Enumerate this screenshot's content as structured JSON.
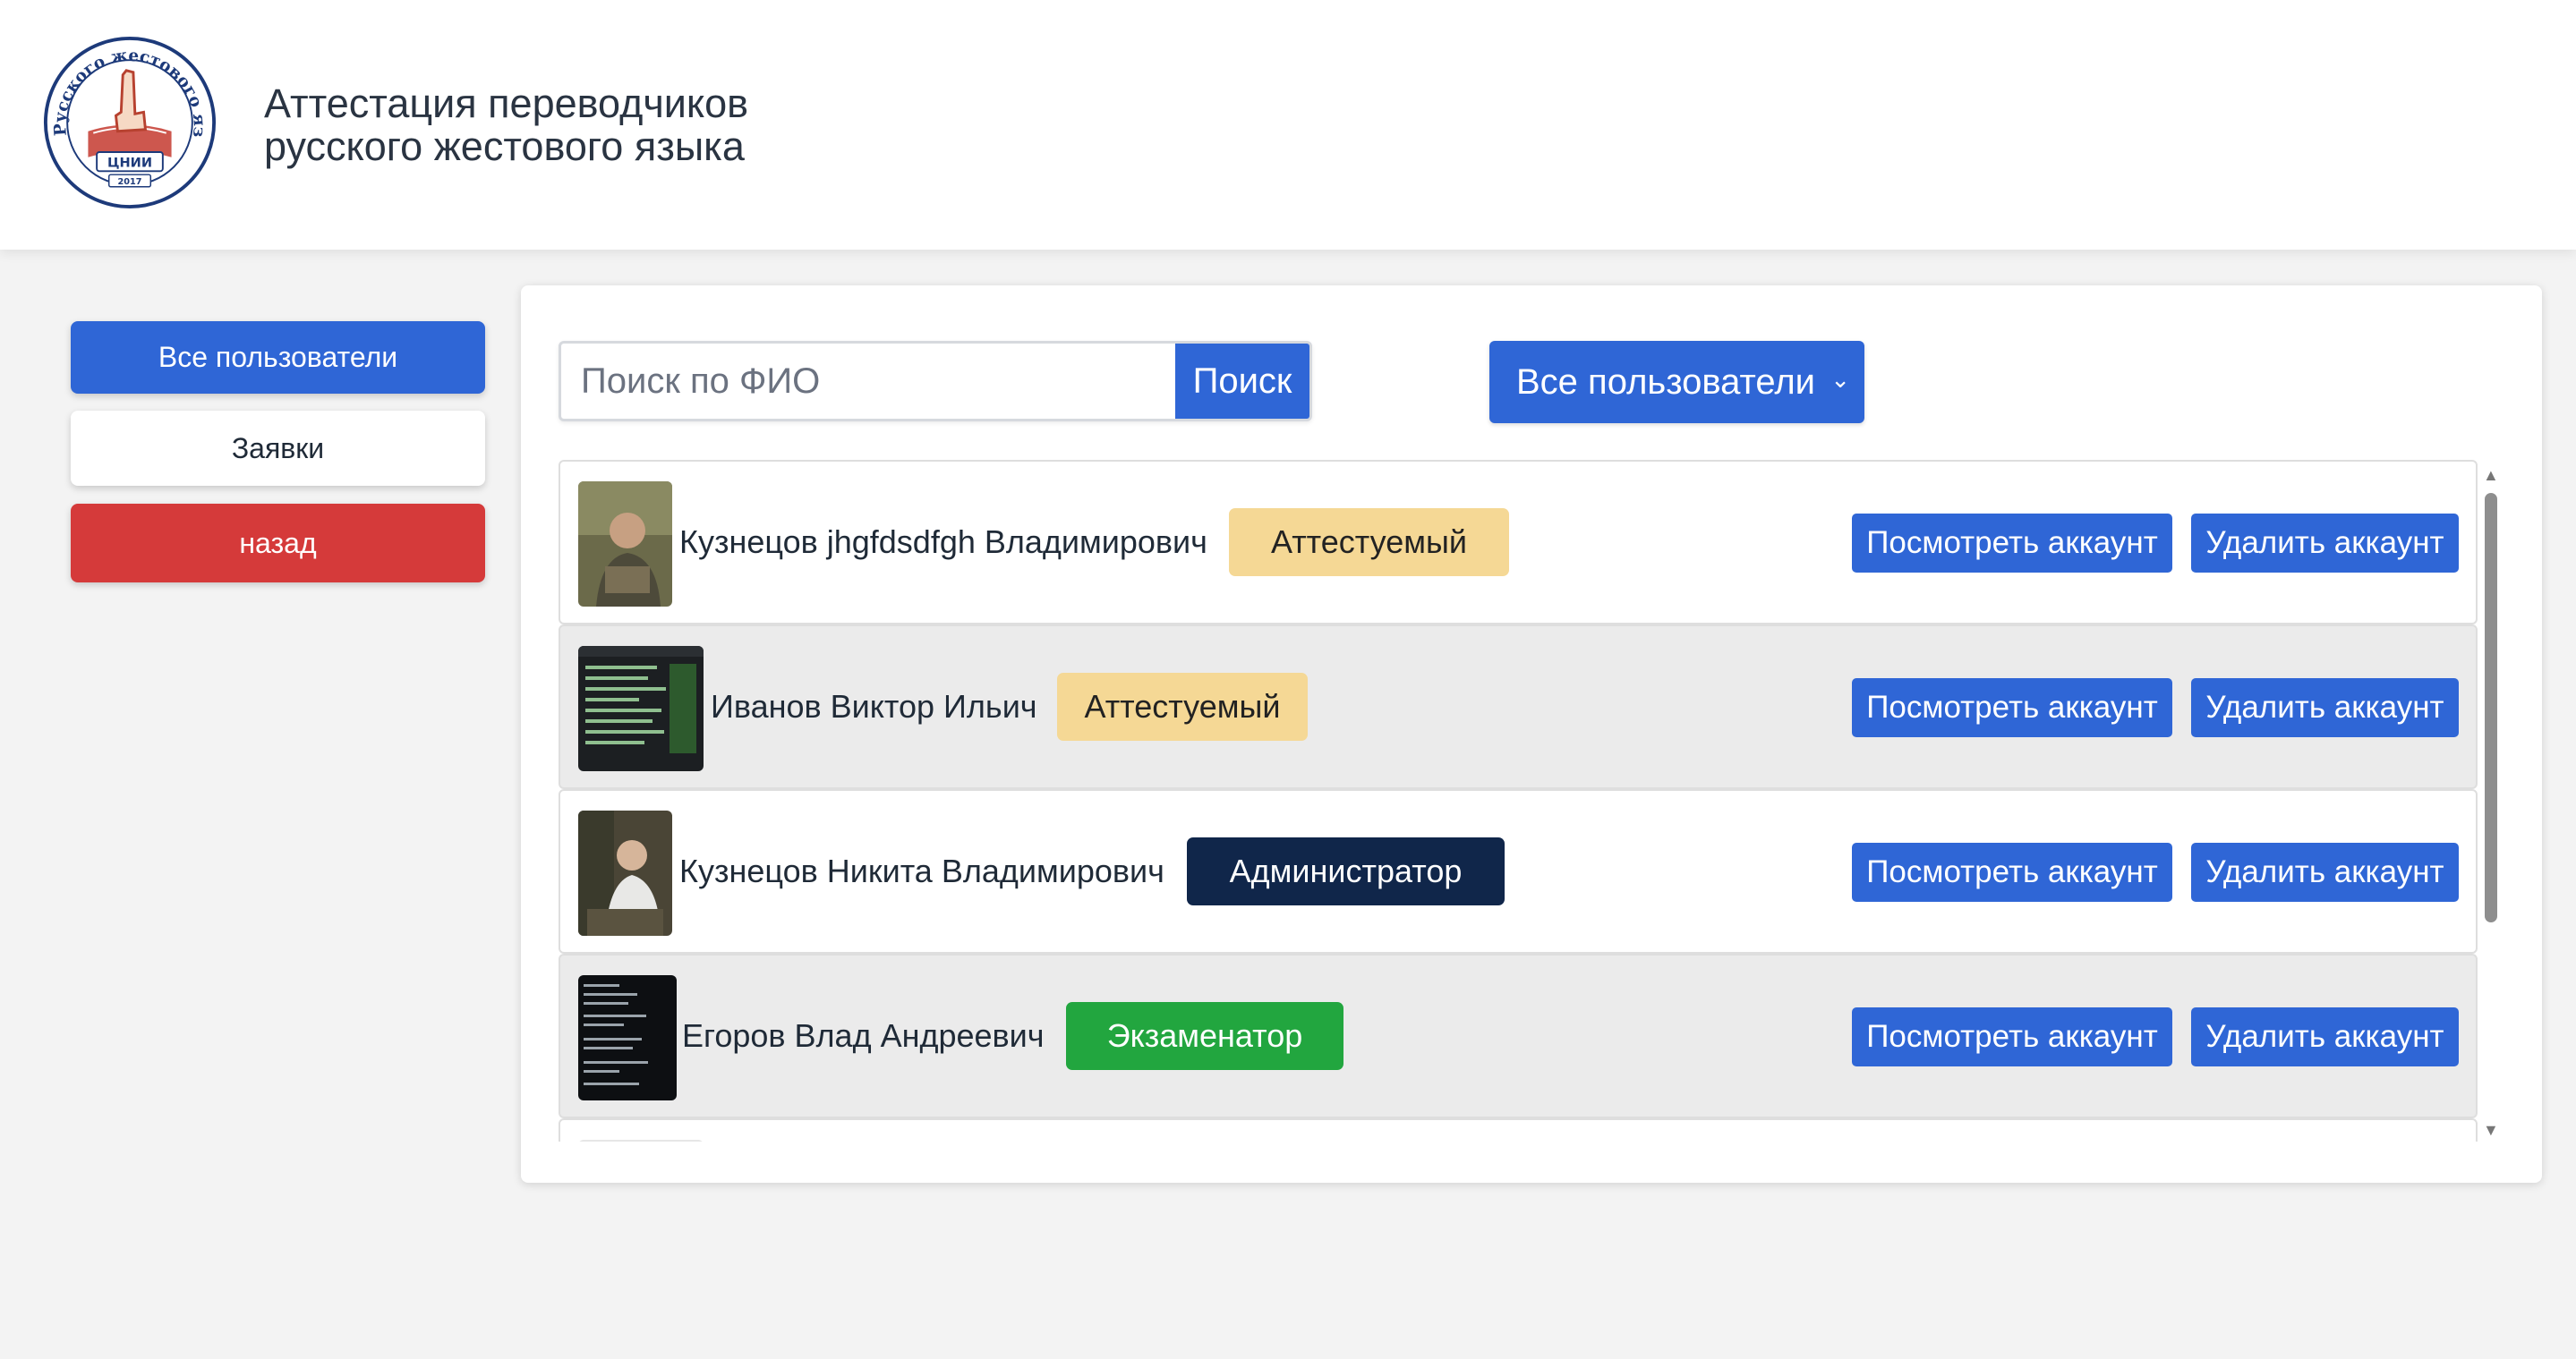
{
  "header": {
    "title_line1": "Аттестация переводчиков",
    "title_line2": "русского жестового языка",
    "logo": {
      "ring_text": "Русского жестового языка",
      "banner_text": "ЦНИИ",
      "year": "2017"
    }
  },
  "sidebar": {
    "items": [
      {
        "label": "Все пользователи",
        "color": "#2f66d6"
      },
      {
        "label": "Заявки",
        "color": "#ffffff"
      },
      {
        "label": "назад",
        "color": "#d53a3a"
      }
    ]
  },
  "search": {
    "placeholder": "Поиск по ФИО",
    "value": "",
    "button_label": "Поиск"
  },
  "filter": {
    "selected": "Все пользователи",
    "icon": "chevron-down-icon"
  },
  "users": [
    {
      "name": "Кузнецов jhgfdsdfgh Владимирович",
      "role": "Аттестуемый",
      "role_color": "#f5d895",
      "avatar": "photo-man-outdoors"
    },
    {
      "name": "Иванов Виктор Ильич",
      "role": "Аттестуемый",
      "role_color": "#f5d895",
      "avatar": "screenshot-terminal"
    },
    {
      "name": "Кузнецов Никита Владимирович",
      "role": "Администратор",
      "role_color": "#10264a",
      "avatar": "photo-man-seated"
    },
    {
      "name": "Егоров Влад Андреевич",
      "role": "Экзаменатор",
      "role_color": "#22a63f",
      "avatar": "screenshot-dark-code"
    }
  ],
  "actions": {
    "view_label": "Посмотреть аккаунт",
    "delete_label": "Удалить аккаунт"
  }
}
